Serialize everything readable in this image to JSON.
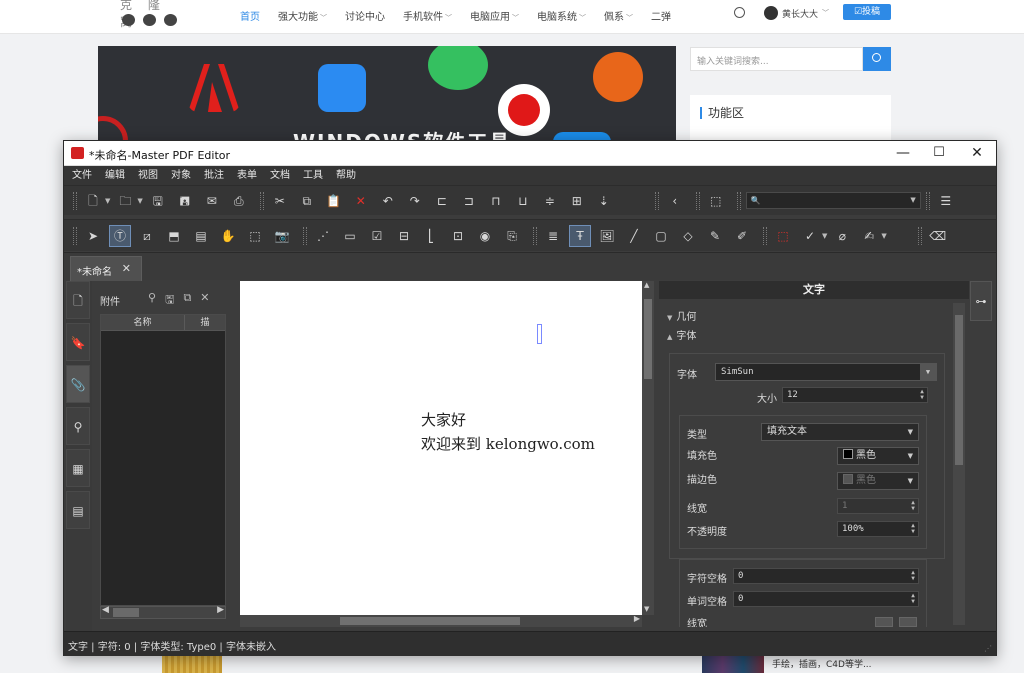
{
  "website": {
    "logo_text": "克 隆 窝",
    "nav": [
      {
        "label": "首页",
        "active": true,
        "caret": false
      },
      {
        "label": "强大功能",
        "active": false,
        "caret": true
      },
      {
        "label": "讨论中心",
        "active": false,
        "caret": false
      },
      {
        "label": "手机软件",
        "active": false,
        "caret": true
      },
      {
        "label": "电脑应用",
        "active": false,
        "caret": true
      },
      {
        "label": "电脑系统",
        "active": false,
        "caret": true
      },
      {
        "label": "佩系",
        "active": false,
        "caret": true
      },
      {
        "label": "二弹",
        "active": false,
        "caret": false
      }
    ],
    "user_name": "黄长大大",
    "post_button": "☑投稿",
    "hero_title": "WINDOWS软件工具",
    "search_placeholder": "输入关键词搜索...",
    "widget_title": "功能区",
    "bottom_item_text": "手绘，插画，C4D等学...",
    "brand_blue": "#2e8ae6"
  },
  "app": {
    "title": "*未命名-Master PDF Editor",
    "window_buttons": {
      "minimize": "—",
      "maximize": "☐",
      "close": "✕"
    },
    "menu": [
      "文件",
      "编辑",
      "视图",
      "对象",
      "批注",
      "表单",
      "文档",
      "工具",
      "帮助"
    ],
    "search_value": "🔍",
    "doc_tab": {
      "label": "*未命名",
      "close": "✕"
    },
    "attachments": {
      "title": "附件",
      "columns": [
        "名称",
        "描"
      ]
    },
    "document": {
      "lines": [
        "大家好",
        "欢迎来到 kelongwo.com"
      ]
    },
    "properties": {
      "panel_title": "文字",
      "section_geometry": "几何",
      "section_text": "字体",
      "font_label": "字体",
      "font_value": "SimSun",
      "size_label": "大小",
      "size_value": "12",
      "type_label": "类型",
      "type_value": "填充文本",
      "fill_label": "填充色",
      "fill_value": "黑色",
      "stroke_label": "描边色",
      "stroke_value": "黑色",
      "line_width_label": "线宽",
      "line_width_value": "1",
      "opacity_label": "不透明度",
      "opacity_value": "100%",
      "char_spacing_label": "字符空格",
      "char_spacing_value": "0",
      "word_spacing_label": "单词空格",
      "word_spacing_value": "0",
      "line_label": "线宽"
    },
    "status": "文字 | 字符: 0 | 字体类型: Type0 | 字体未嵌入",
    "accent_red": "#d32222"
  }
}
